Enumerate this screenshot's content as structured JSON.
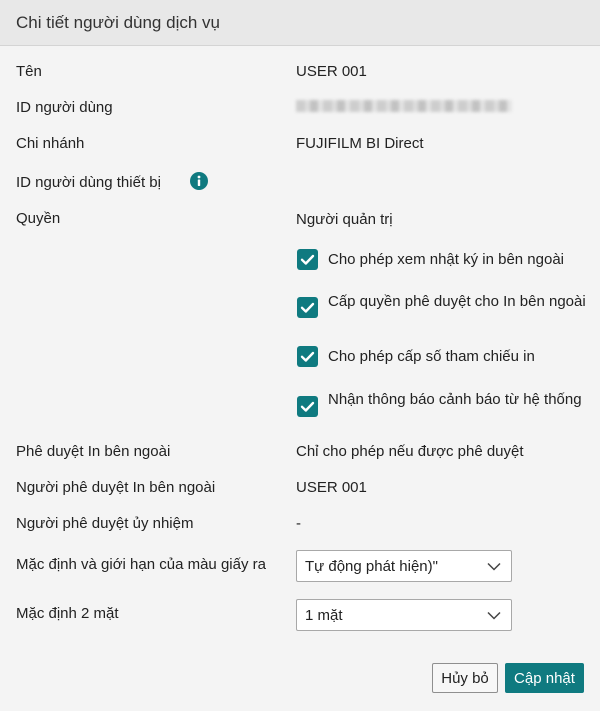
{
  "dialog": {
    "title": "Chi tiết người dùng dịch vụ"
  },
  "fields": {
    "name": {
      "label": "Tên",
      "value": "USER 001"
    },
    "user_id": {
      "label": "ID người dùng"
    },
    "branch": {
      "label": "Chi nhánh",
      "value": "FUJIFILM BI Direct"
    },
    "device_user_id": {
      "label": "ID người dùng thiết bị"
    },
    "role": {
      "label": "Quyền",
      "value": "Người quản trị"
    },
    "external_print_approval": {
      "label": "Phê duyệt In bên ngoài",
      "value": "Chỉ cho phép nếu được phê duyệt"
    },
    "external_print_approver": {
      "label": "Người phê duyệt In bên ngoài",
      "value": "USER 001"
    },
    "delegated_approver": {
      "label": "Người phê duyệt ủy nhiệm",
      "value": "-"
    },
    "output_color": {
      "label": "Mặc định và giới hạn của màu giấy ra",
      "value": "Tự động phát hiện)\""
    },
    "duplex_default": {
      "label": "Mặc định 2 mặt",
      "value": "1 mặt"
    }
  },
  "permissions": [
    {
      "label": "Cho phép xem nhật ký in bên ngoài",
      "checked": true
    },
    {
      "label": "Cấp quyền phê duyệt cho In bên ngoài",
      "checked": true
    },
    {
      "label": "Cho phép cấp số tham chiếu in",
      "checked": true
    },
    {
      "label": "Nhận thông báo cảnh báo từ hệ thống",
      "checked": true
    }
  ],
  "buttons": {
    "cancel": "Hủy bỏ",
    "update": "Cập nhật"
  },
  "icons": {
    "info": "info-icon",
    "checkbox": "checkmark-icon",
    "select": "chevron-down-icon"
  },
  "colors": {
    "accent": "#0f7a80",
    "header_bg": "#e8e8e8",
    "body_bg": "#f4f4f4"
  }
}
